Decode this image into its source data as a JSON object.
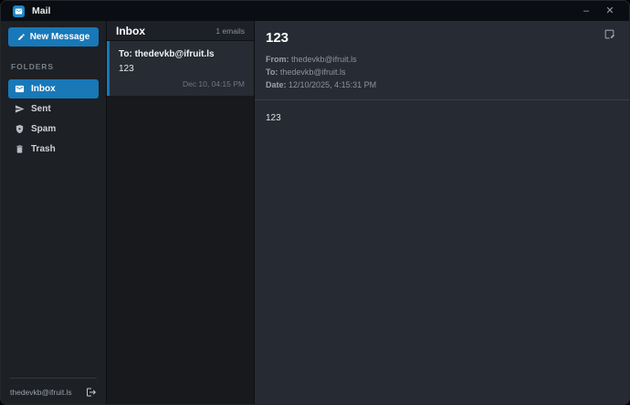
{
  "window": {
    "title": "Mail",
    "minimize": "–",
    "close": "✕"
  },
  "colors": {
    "accent": "#1878b8",
    "titlebar": "#0a0d11",
    "panel": "#272b33"
  },
  "sidebar": {
    "new_message": "New Message",
    "folders_heading": "FOLDERS",
    "folders": [
      {
        "label": "Inbox",
        "icon": "inbox-envelope-icon",
        "selected": true
      },
      {
        "label": "Sent",
        "icon": "paper-plane-icon",
        "selected": false
      },
      {
        "label": "Spam",
        "icon": "shield-icon",
        "selected": false
      },
      {
        "label": "Trash",
        "icon": "trash-icon",
        "selected": false
      }
    ],
    "account_email": "thedevkb@ifruit.ls"
  },
  "list": {
    "title": "Inbox",
    "count": "1 emails",
    "emails": [
      {
        "to": "To: thedevkb@ifruit.ls",
        "subject": "123",
        "time": "Dec 10, 04:15 PM",
        "selected": true
      }
    ]
  },
  "reader": {
    "subject": "123",
    "from_label": "From:",
    "from_value": "thedevkb@ifruit.ls",
    "to_label": "To:",
    "to_value": "thedevkb@ifruit.ls",
    "date_label": "Date:",
    "date_value": "12/10/2025, 4:15:31 PM",
    "body": "123"
  }
}
